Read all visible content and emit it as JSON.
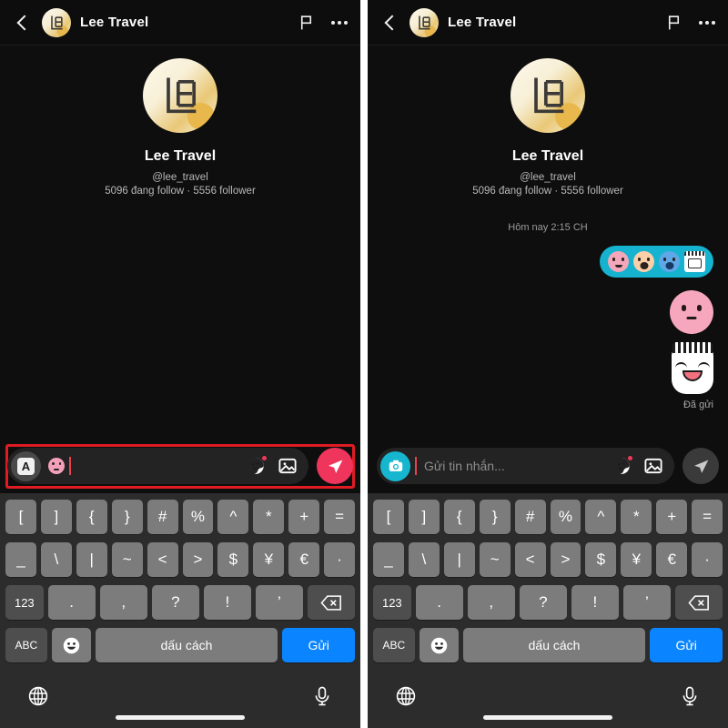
{
  "panels": [
    {
      "id": "left",
      "header": {
        "back_icon": "back-chevron-icon",
        "title": "Lee Travel",
        "flag_icon": "flag-icon",
        "more_icon": "more-dots-icon"
      },
      "profile": {
        "avatar_icon": "lee-travel-logo-avatar",
        "name": "Lee Travel",
        "handle": "@lee_travel",
        "stats": "5096 đang follow · 5556 follower"
      },
      "composer": {
        "highlighted": true,
        "highlight_color": "#e01b24",
        "leading_icon": "text-style-a-button",
        "leading_label": "A",
        "typed_sticker_icon": "pink-face-emoji",
        "placeholder": "",
        "sticker_icon": "sticker-icon",
        "gallery_icon": "image-icon",
        "send_icon": "send-paperplane-icon",
        "send_state": "active",
        "send_color": "#f0355c"
      }
    },
    {
      "id": "right",
      "header": {
        "back_icon": "back-chevron-icon",
        "title": "Lee Travel",
        "flag_icon": "flag-icon",
        "more_icon": "more-dots-icon"
      },
      "profile": {
        "avatar_icon": "lee-travel-logo-avatar",
        "name": "Lee Travel",
        "handle": "@lee_travel",
        "stats": "5096 đang follow · 5556 follower"
      },
      "thread": {
        "daystamp": "Hôm nay 2:15 CH",
        "messages": [
          {
            "type": "emoji-bubble",
            "bubble_color": "#15b3cf",
            "emojis": [
              "pink-smile-emoji",
              "peach-shout-emoji",
              "blue-cry-emoji",
              "note-sticker-emoji"
            ]
          },
          {
            "type": "sticker",
            "sticker_icon": "pink-blank-face-sticker"
          },
          {
            "type": "sticker",
            "sticker_icon": "white-cat-smile-sticker"
          }
        ],
        "status": "Đã gửi"
      },
      "composer": {
        "highlighted": false,
        "leading_icon": "camera-button",
        "placeholder": "Gửi tin nhắn...",
        "sticker_icon": "sticker-icon",
        "gallery_icon": "image-icon",
        "send_icon": "send-paperplane-icon",
        "send_state": "idle",
        "send_color": "#3a3a3a"
      }
    }
  ],
  "keyboard": {
    "row1": [
      "[",
      "]",
      "{",
      "}",
      "#",
      "%",
      "^",
      "*",
      "+",
      "="
    ],
    "row2": [
      "_",
      "\\",
      "|",
      "~",
      "<",
      ">",
      "$",
      "¥",
      "€",
      "·"
    ],
    "row3": [
      "123",
      ".",
      ",",
      "?",
      "!",
      "’",
      "backspace-icon"
    ],
    "row3_keys": [
      "123",
      ".",
      ",",
      "?",
      "!",
      "’"
    ],
    "row4": {
      "abc": "ABC",
      "emoji": "emoji-smiley-icon",
      "space": "dấu cách",
      "send": "Gửi"
    },
    "send_color": "#0a84ff"
  },
  "bottom_bar": {
    "globe_icon": "globe-icon",
    "mic_icon": "microphone-icon",
    "home_indicator": "home-indicator"
  }
}
